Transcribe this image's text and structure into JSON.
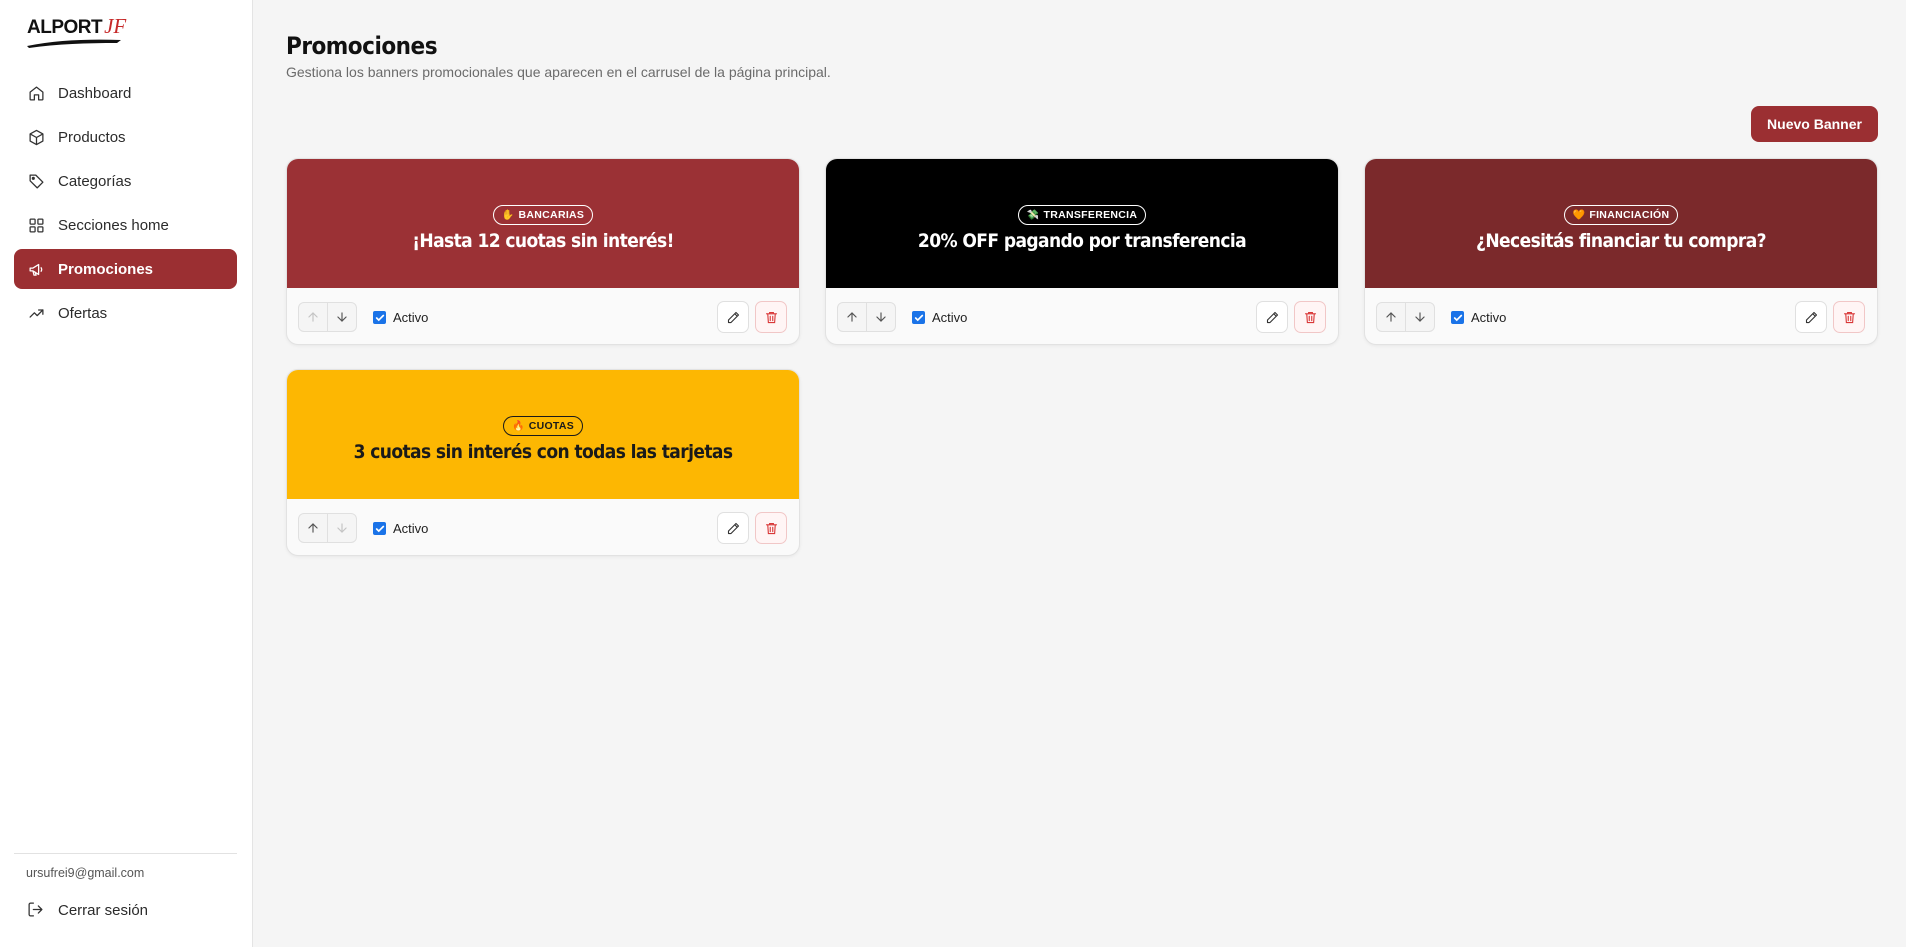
{
  "brand": {
    "name": "ALPORT",
    "suffix": "JF"
  },
  "sidebar": {
    "items": [
      {
        "label": "Dashboard",
        "icon": "home-icon"
      },
      {
        "label": "Productos",
        "icon": "box-icon"
      },
      {
        "label": "Categorías",
        "icon": "tag-icon"
      },
      {
        "label": "Secciones home",
        "icon": "grid-icon"
      },
      {
        "label": "Promociones",
        "icon": "megaphone-icon",
        "active": true
      },
      {
        "label": "Ofertas",
        "icon": "trending-up-icon"
      }
    ],
    "email": "ursufrei9@gmail.com",
    "logout_label": "Cerrar sesión"
  },
  "header": {
    "title": "Promociones",
    "subtitle": "Gestiona los banners promocionales que aparecen en el carrusel de la página principal.",
    "new_button": "Nuevo Banner"
  },
  "banners": [
    {
      "badge": "BANCARIAS",
      "badge_icon": "hand",
      "title": "¡Hasta 12 cuotas sin interés!",
      "bg": "#9b3135",
      "fg": "#ffffff",
      "active_label": "Activo",
      "active": true
    },
    {
      "badge": "TRANSFERENCIA",
      "badge_icon": "money",
      "title": "20% OFF pagando por transferencia",
      "bg": "#000000",
      "fg": "#ffffff",
      "active_label": "Activo",
      "active": true
    },
    {
      "badge": "FINANCIACIÓN",
      "badge_icon": "heart",
      "title": "¿Necesitás financiar tu compra?",
      "bg": "#7b292b",
      "fg": "#ffffff",
      "active_label": "Activo",
      "active": true
    },
    {
      "badge": "CUOTAS",
      "badge_icon": "fire",
      "title": "3 cuotas sin interés con todas las tarjetas",
      "bg": "#fdb702",
      "fg": "#1a1a1a",
      "active_label": "Activo",
      "active": true
    }
  ],
  "colors": {
    "accent": "#9b2f32",
    "danger": "#d93838",
    "checkbox": "#1a73e8"
  }
}
